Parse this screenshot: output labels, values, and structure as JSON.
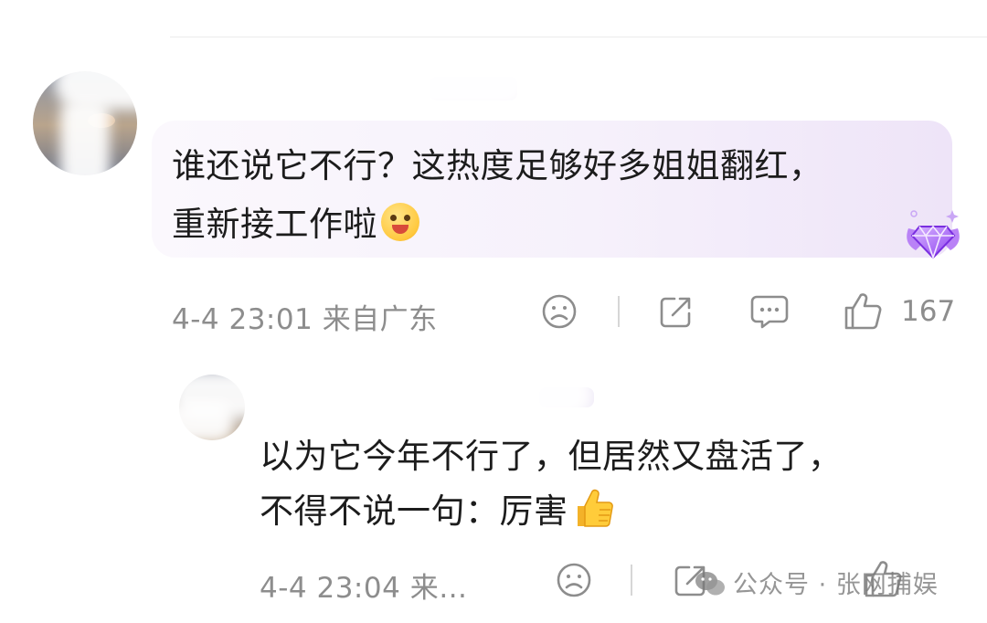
{
  "comments": [
    {
      "text_line_1": "谁还说它不行？这热度足够好多姐姐翻红，",
      "text_line_2": "重新接工作啦",
      "emoji": "drooling-face-emoji",
      "time": "4-4 23:01",
      "location": "来自广东",
      "likes": "167",
      "badge": "diamond-fan-badge"
    },
    {
      "text_line_1": "以为它今年不行了，但居然又盘活了，",
      "text_line_2": "不得不说一句：厉害",
      "emoji": "thumbs-up-emoji",
      "time": "4-4 23:04",
      "location": "来…"
    }
  ],
  "watermark": {
    "text": "公众号 · 张网捕娱"
  },
  "colors": {
    "bubble_start": "#fbf8fd",
    "bubble_end": "#eee4f8",
    "meta_text": "#8d8d8d",
    "badge_purple": "#a45df0"
  }
}
